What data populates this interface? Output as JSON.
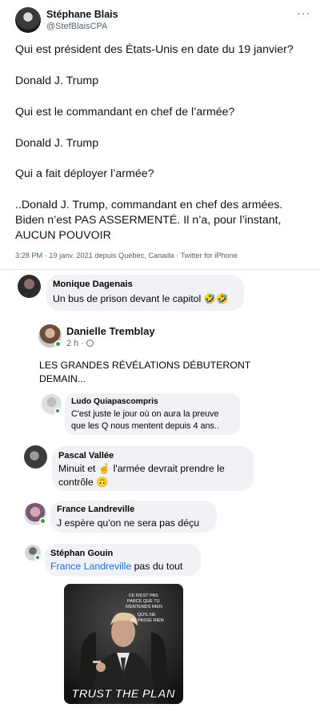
{
  "tweet": {
    "author_name": "Stéphane Blais",
    "author_handle": "@StefBlaisCPA",
    "more_label": "···",
    "lines": [
      "Qui est président des États-Unis en date du 19 janvier?",
      "Donald J. Trump",
      "Qui est le commandant en chef de l’armée?",
      "Donald J. Trump",
      "Qui a fait déployer l’armée?",
      "..Donald J. Trump, commandant en chef des armées.",
      "Biden n’est PAS ASSERMENTÉ. Il n’a, pour l’instant,",
      "AUCUN POUVOIR"
    ],
    "meta": "3:28 PM · 19 janv. 2021 depuis Québec, Canada · Twitter for iPhone"
  },
  "comments": {
    "c1": {
      "name": "Monique Dagenais",
      "text": "Un bus de prison devant le capitol 🤣🤣"
    },
    "post": {
      "name": "Danielle Tremblay",
      "time": "2 h ·",
      "text_lines": [
        "LES GRANDES RÉVÉLATIONS DÉBUTERONT",
        "DEMAIN..."
      ],
      "reply": {
        "name": "Ludo Quiapascompris",
        "text_lines": [
          "C'est juste le jour où on aura la preuve",
          "que les Q nous mentent depuis 4 ans.."
        ]
      }
    },
    "c3": {
      "name": "Pascal Vallée",
      "text_lines": [
        "Minuit et ☝️ l'armée devrait prendre le",
        "contrôle 🙃"
      ]
    },
    "c4": {
      "name": "France Landreville",
      "text": "J espère qu'on ne sera pas déçu"
    },
    "c5": {
      "name": "Stéphan Gouin",
      "mention": "France Landreville",
      "text": " pas du tout"
    }
  },
  "meme": {
    "caption_top": [
      "CE N'EST PAS",
      "PARCE QUE TU",
      "N'ENTENDS RIEN"
    ],
    "caption_mid": [
      "QU'IL NE",
      "SE PASSE RIEN"
    ],
    "caption_bottom": "TRUST THE PLAN"
  },
  "colors": {
    "link": "#216fdb",
    "bubble": "#f0f2f5",
    "online": "#31a24c",
    "meta": "#536471"
  }
}
